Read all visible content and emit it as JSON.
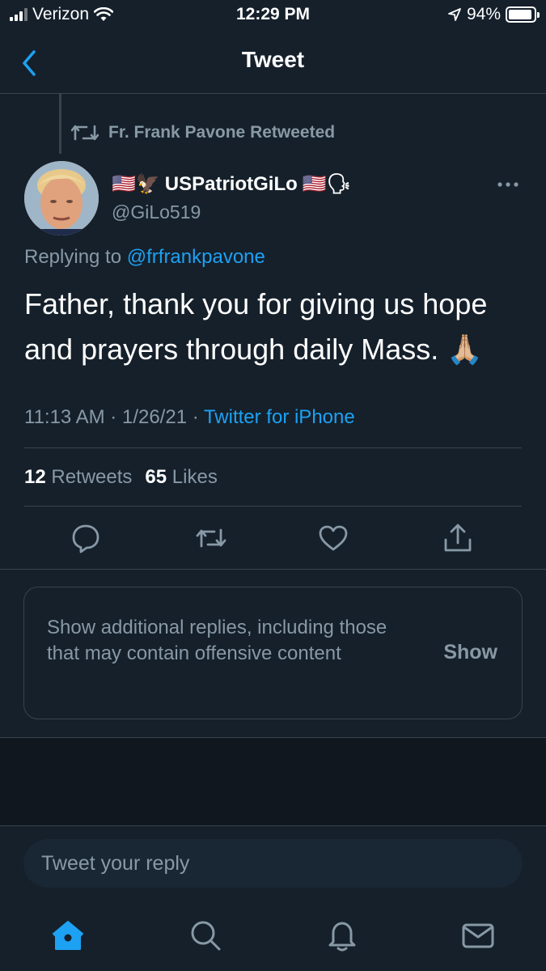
{
  "status_bar": {
    "carrier": "Verizon",
    "time": "12:29 PM",
    "battery": "94%",
    "battery_level": 0.94
  },
  "header": {
    "title": "Tweet"
  },
  "tweet": {
    "retweeted_by": "Fr. Frank Pavone Retweeted",
    "display_name": "USPatriotGiLo",
    "name_emojis_prefix": "🇺🇸🦅",
    "name_emojis_suffix": "🇺🇸🗣",
    "handle": "@GiLo519",
    "replying_to_label": "Replying to",
    "replying_to_handle": "@frfrankpavone",
    "text": "Father, thank you for giving us hope and prayers through daily Mass. 🙏🏼",
    "time": "11:13 AM",
    "date": "1/26/21",
    "separator": "·",
    "source": "Twitter for iPhone",
    "retweets_count": "12",
    "retweets_label": "Retweets",
    "likes_count": "65",
    "likes_label": "Likes"
  },
  "additional_replies": {
    "message": "Show additional replies, including those that may contain offensive content",
    "show_label": "Show"
  },
  "reply": {
    "placeholder": "Tweet your reply"
  },
  "colors": {
    "background": "#15202b",
    "accent": "#1da1f2",
    "muted": "#8899a6",
    "divider": "#38444d"
  },
  "icons": [
    "back-icon",
    "retweet-icon",
    "more-icon",
    "reply-icon",
    "retweet-action-icon",
    "like-icon",
    "share-icon",
    "home-icon",
    "search-icon",
    "notifications-icon",
    "messages-icon"
  ]
}
